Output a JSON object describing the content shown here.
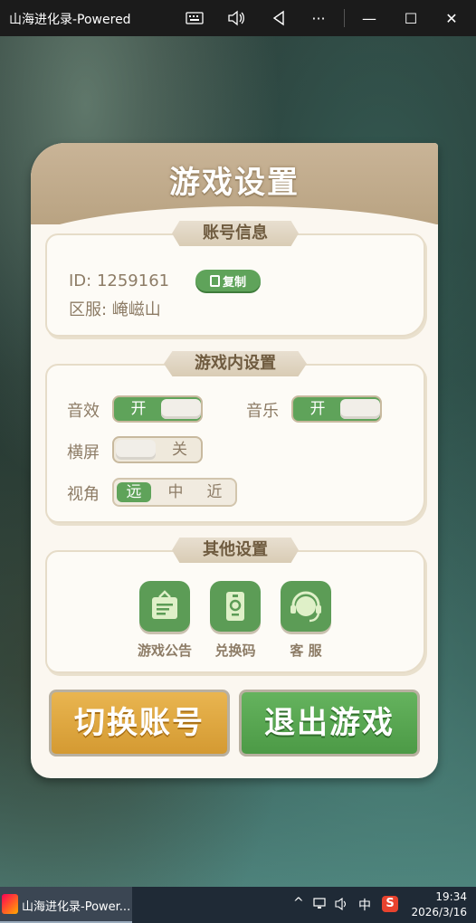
{
  "window": {
    "title": "山海进化录-Powered",
    "keyboard_icon": "keyboard-icon",
    "volume_icon": "speaker-icon",
    "back_icon": "back-triangle-icon",
    "more_label": "···",
    "minimize_label": "—",
    "maximize_label": "☐",
    "close_label": "✕"
  },
  "panel": {
    "title": "游戏设置",
    "account": {
      "label": "账号信息",
      "id_text": "ID: 1259161",
      "copy_label": "复制",
      "server_text": "区服: 崦嵫山"
    },
    "ingame": {
      "label": "游戏内设置",
      "sfx_label": "音效",
      "sfx_state": "开",
      "music_label": "音乐",
      "music_state": "开",
      "landscape_label": "横屏",
      "landscape_state": "关",
      "view_label": "视角",
      "view_options": [
        "远",
        "中",
        "近"
      ]
    },
    "other": {
      "label": "其他设置",
      "items": [
        {
          "label": "游戏公告",
          "icon": "notice-board-icon"
        },
        {
          "label": "兑换码",
          "icon": "redeem-code-icon"
        },
        {
          "label": "客 服",
          "icon": "headset-icon"
        }
      ]
    },
    "switch_account_label": "切换账号",
    "exit_game_label": "退出游戏"
  },
  "taskbar": {
    "app_label": "山海进化录-Power...",
    "tray_chevron": "^",
    "ime_label": "中",
    "time": "19:34",
    "date": "2026/3/16"
  },
  "colors": {
    "accent_green": "#5fa35a",
    "gold_button": "#e0a840",
    "panel_bg": "#fbf7f0",
    "header_tan": "#c1ab8c"
  }
}
